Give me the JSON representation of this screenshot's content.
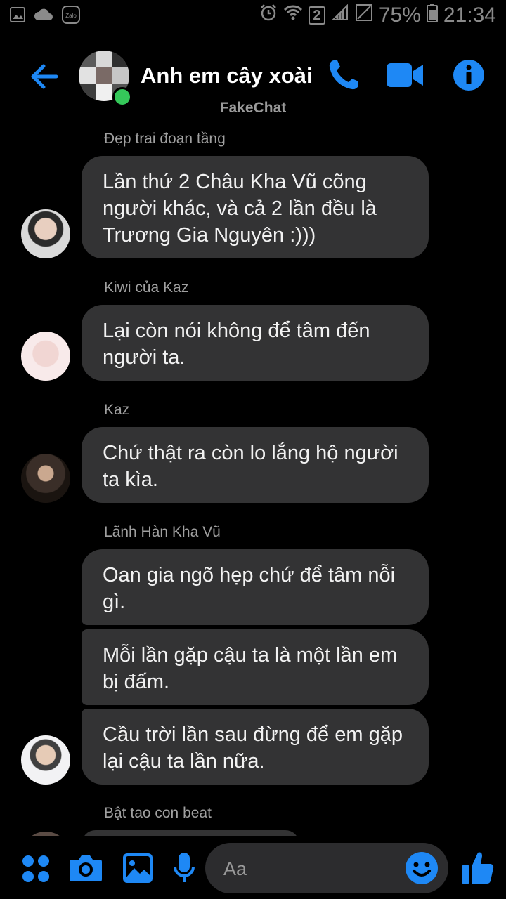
{
  "status_bar": {
    "battery": "75%",
    "time": "21:34",
    "sim_slot": "2",
    "notification_icons": [
      "gallery-icon",
      "cloud-icon",
      "zalo-icon"
    ]
  },
  "header": {
    "title": "Anh em cây xoài",
    "subtitle": "FakeChat",
    "accent_color": "#1e88f5",
    "online": true
  },
  "messages": [
    {
      "sender": "Đẹp trai đoạn tầng",
      "bubbles": [
        "Lần thứ 2 Châu Kha Vũ cõng người khác, và cả 2 lần đều là Trương Gia Nguyên :)))"
      ]
    },
    {
      "sender": "Kiwi của Kaz",
      "bubbles": [
        "Lại còn nói không để tâm đến người ta."
      ]
    },
    {
      "sender": "Kaz",
      "bubbles": [
        "Chứ thật ra còn lo lắng hộ người ta kìa."
      ]
    },
    {
      "sender": "Lãnh Hàn Kha Vũ",
      "bubbles": [
        "Oan gia ngõ hẹp chứ để tâm nỗi gì.",
        "Mỗi lần gặp cậu ta là một lần em bị đấm.",
        "Cầu trời lần sau đừng để em gặp lại cậu ta lần nữa."
      ]
    },
    {
      "sender": "Bật tao con beat",
      "bubbles": []
    }
  ],
  "composer": {
    "placeholder": "Aa"
  }
}
